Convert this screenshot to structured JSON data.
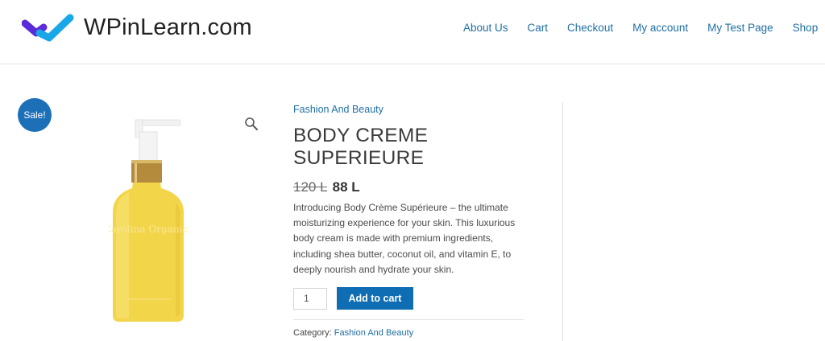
{
  "header": {
    "site_title": "WPinLearn.com",
    "nav": [
      "About Us",
      "Cart",
      "Checkout",
      "My account",
      "My Test Page",
      "Shop"
    ]
  },
  "product": {
    "sale_badge": "Sale!",
    "category_top": "Fashion And Beauty",
    "title": "BODY CREME SUPERIEURE",
    "old_price": "120 L",
    "new_price": "88 L",
    "description": "Introducing Body Crème Supérieure – the ultimate moisturizing experience for your skin. This luxurious body cream is made with premium ingredients, including shea butter, coconut oil, and vitamin E, to deeply nourish and hydrate your skin.",
    "quantity": "1",
    "add_to_cart": "Add to cart",
    "category_label": "Category:",
    "category_value": "Fashion And Beauty",
    "bottle_label": "Carolina Organics"
  },
  "colors": {
    "accent": "#1d70b8",
    "link": "#1f6fa5",
    "bottle": "#f3d54a"
  },
  "icons": [
    "logo-icon",
    "search-icon"
  ]
}
